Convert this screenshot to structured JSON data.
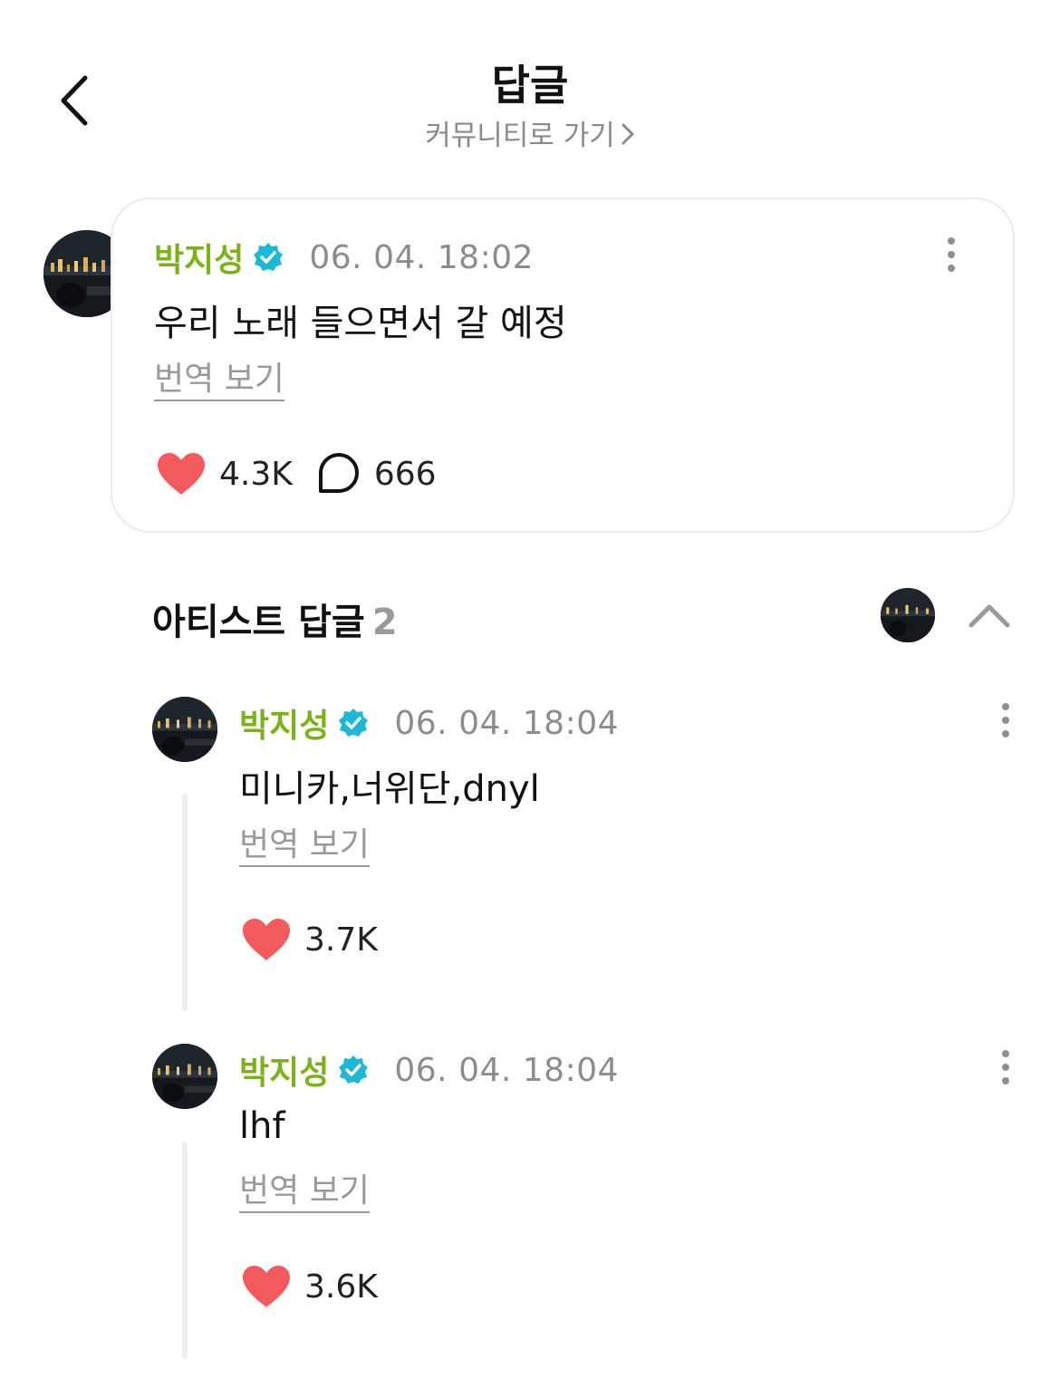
{
  "header": {
    "title": "답글",
    "community_link": "커뮤니티로 가기"
  },
  "post": {
    "author": "박지성",
    "timestamp": "06. 04. 18:02",
    "text": "우리 노래 들으면서 갈 예정",
    "translate_label": "번역 보기",
    "likes": "4.3K",
    "comments": "666"
  },
  "artist_replies": {
    "title": "아티스트 답글",
    "count": "2",
    "items": [
      {
        "author": "박지성",
        "timestamp": "06. 04. 18:04",
        "text": "미니카,너위단,dnyl",
        "translate_label": "번역 보기",
        "likes": "3.7K"
      },
      {
        "author": "박지성",
        "timestamp": "06. 04. 18:04",
        "text": "lhf",
        "translate_label": "번역 보기",
        "likes": "3.6K"
      }
    ]
  },
  "colors": {
    "author_name": "#7ab317",
    "verified_badge": "#1cb8d4",
    "heart": "#f25a5e",
    "muted_text": "#8c8c8c"
  },
  "icons": {
    "back": "chevron-left-icon",
    "more": "more-vertical-icon",
    "like": "heart-icon",
    "comment": "comment-bubble-icon",
    "verified": "verified-badge-icon",
    "collapse": "chevron-up-icon"
  }
}
